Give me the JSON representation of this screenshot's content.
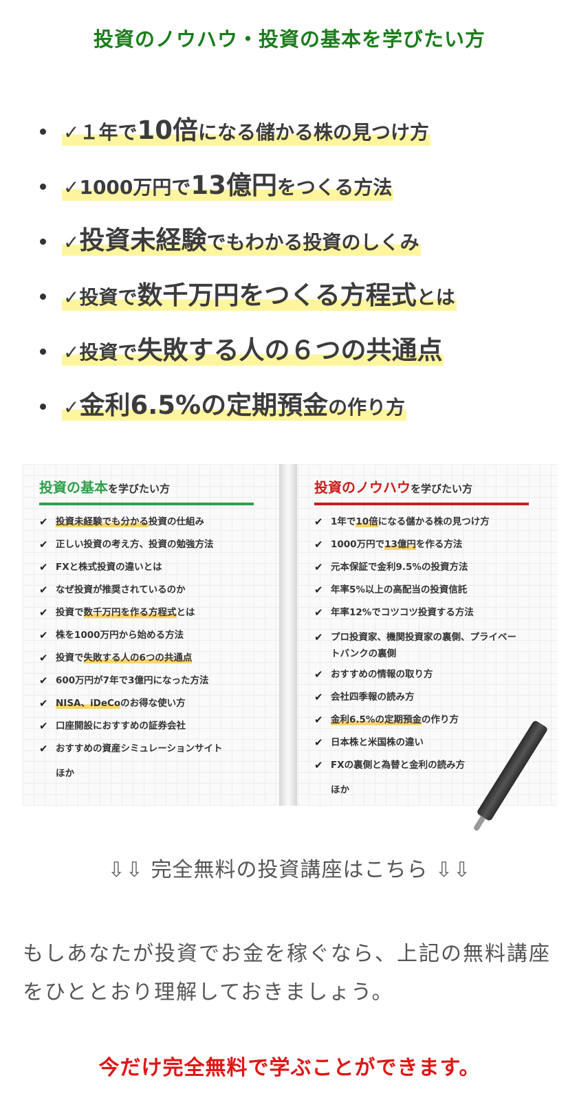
{
  "headline": "投資のノウハウ・投資の基本を学びたい方",
  "bullets": [
    {
      "check": "✓",
      "parts": [
        {
          "t": "１年で",
          "s": "sm"
        },
        {
          "t": "10倍",
          "s": "lg"
        },
        {
          "t": "になる儲かる株の見つけ方",
          "s": "sm"
        }
      ]
    },
    {
      "check": "✓",
      "parts": [
        {
          "t": "1000",
          "s": "sm"
        },
        {
          "t": "万円で",
          "s": "sm"
        },
        {
          "t": "13億円",
          "s": "lg"
        },
        {
          "t": "をつくる方法",
          "s": "sm"
        }
      ]
    },
    {
      "check": "✓",
      "parts": [
        {
          "t": "投資未経験",
          "s": "lg"
        },
        {
          "t": "でもわかる投資のしくみ",
          "s": "sm"
        }
      ]
    },
    {
      "check": "✓",
      "parts": [
        {
          "t": "投資で",
          "s": "sm"
        },
        {
          "t": "数千万円をつくる方程式",
          "s": "lg"
        },
        {
          "t": "とは",
          "s": "sm"
        }
      ]
    },
    {
      "check": "✓",
      "parts": [
        {
          "t": "投資で",
          "s": "sm"
        },
        {
          "t": "失敗する人の６つの共通点",
          "s": "lg"
        }
      ]
    },
    {
      "check": "✓",
      "parts": [
        {
          "t": "金利6.5%の定期預金",
          "s": "lg"
        },
        {
          "t": "の作り方",
          "s": "sm"
        }
      ]
    }
  ],
  "left_card": {
    "title_em": "投資の基本",
    "title_rest": "を学びたい方",
    "items": [
      {
        "hl": "投資未経験でも分かる",
        "rest": "投資の仕組み"
      },
      {
        "hl": "",
        "rest": "正しい投資の考え方、投資の勉強方法"
      },
      {
        "hl": "",
        "rest": "FXと株式投資の違いとは"
      },
      {
        "hl": "",
        "rest": "なぜ投資が推奨されているのか"
      },
      {
        "pre": "投資で",
        "hl": "数千万円を作る方程式",
        "rest": "とは"
      },
      {
        "hl": "",
        "rest": "株を1000万円から始める方法"
      },
      {
        "pre": "投資で",
        "hl": "失敗する人の6つの共通点",
        "rest": ""
      },
      {
        "hl": "",
        "rest": "600万円が7年で3億円になった方法"
      },
      {
        "hl": "NISA、iDeCo",
        "rest": "のお得な使い方"
      },
      {
        "hl": "",
        "rest": "口座開設におすすめの証券会社"
      },
      {
        "hl": "",
        "rest": "おすすめの資産シミュレーションサイト"
      }
    ],
    "etc": "ほか"
  },
  "right_card": {
    "title_em": "投資のノウハウ",
    "title_rest": "を学びたい方",
    "items": [
      {
        "pre": "1年で",
        "hl": "10倍",
        "rest": "になる儲かる株の見つけ方"
      },
      {
        "pre": "1000万円で",
        "hl": "13億円",
        "rest": "を作る方法"
      },
      {
        "hl": "",
        "rest": "元本保証で金利9.5%の投資方法"
      },
      {
        "hl": "",
        "rest": "年率5%以上の高配当の投資信託"
      },
      {
        "hl": "",
        "rest": "年率12%でコツコツ投資する方法"
      },
      {
        "hl": "",
        "rest": "プロ投資家、機関投資家の裏側、プライベートバンクの裏側",
        "tall": true
      },
      {
        "hl": "",
        "rest": "おすすめの情報の取り方"
      },
      {
        "hl": "",
        "rest": "会社四季報の読み方"
      },
      {
        "hl": "金利6.5%の定期預金",
        "rest": "の作り方"
      },
      {
        "hl": "",
        "rest": "日本株と米国株の違い"
      },
      {
        "hl": "",
        "rest": "FXの裏側と為替と金利の読み方"
      }
    ],
    "etc": "ほか"
  },
  "cta": {
    "arrows_left": "⇩⇩",
    "text": " 完全無料の投資講座はこちら ",
    "arrows_right": "⇩⇩"
  },
  "paragraph": "もしあなたが投資でお金を稼ぐなら、上記の無料講座をひととおり理解しておきましょう。",
  "free_note": "今だけ完全無料で学ぶことができます。"
}
